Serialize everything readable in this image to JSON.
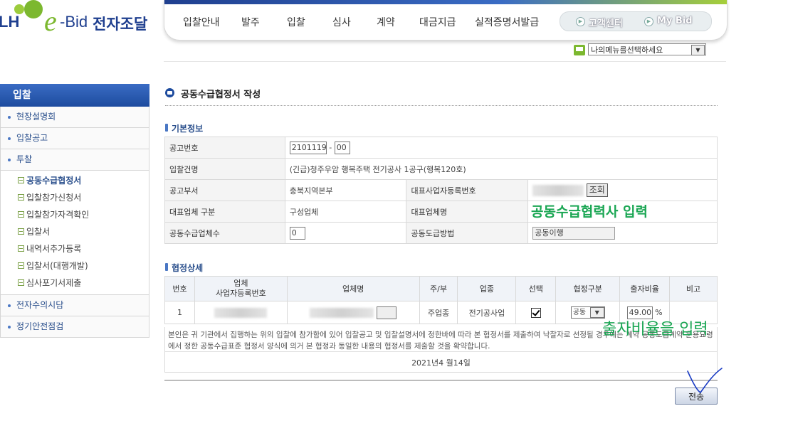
{
  "header": {
    "logo": {
      "lh": "LH",
      "e": "e",
      "bid": "-Bid",
      "korean": "전자조달"
    },
    "menus": [
      "입찰안내",
      "발주",
      "입찰",
      "심사",
      "계약",
      "대금지급",
      "실적증명서발급"
    ],
    "quick_links": [
      "고객센터",
      "My Bid"
    ],
    "my_menu_select": "나의메뉴를선택하세요"
  },
  "sidebar": {
    "title": "입찰",
    "items_top": [
      "현장설명회",
      "입찰공고",
      "투찰"
    ],
    "sub_items": [
      "공동수급협정서",
      "입찰참가신청서",
      "입찰참가자격확인",
      "입찰서",
      "내역서추가등록",
      "입찰서(대행개발)",
      "심사포기서제출"
    ],
    "items_bottom": [
      "전자수의시담",
      "정기안전점검"
    ]
  },
  "page": {
    "title": "공동수급협정서 작성",
    "basic_section": "기본정보",
    "detail_section": "협정상세"
  },
  "basic": {
    "labels": {
      "notice_no": "공고번호",
      "bid_name": "입찰건명",
      "dept": "공고부서",
      "rep_bizno": "대표사업자등록번호",
      "rep_type": "대표업체 구분",
      "rep_name": "대표업체명",
      "joint_count": "공동수급업체수",
      "joint_method": "공동도급방법"
    },
    "notice_no": "2101119",
    "notice_seq": "00",
    "bid_name": "(긴급)청주우암 행복주택 전기공사 1공구(행복120호)",
    "dept": "충북지역본부",
    "lookup_button": "조회",
    "rep_type": "구성업체",
    "joint_count": "0",
    "joint_method": "공동이행"
  },
  "detail": {
    "headers": [
      "번호",
      "업체\n사업자등록번호",
      "업체명",
      "주/부",
      "업종",
      "선택",
      "협정구분",
      "출자비율",
      "비고"
    ],
    "rows": [
      {
        "no": "1",
        "role": "주업종",
        "industry": "전기공사업",
        "agree_type": "공동",
        "ratio": "49.00",
        "unit": "%"
      }
    ]
  },
  "agreement": {
    "text": "본인은 귀 기관에서 집행하는 위의 입찰에 참가함에 있어 입찰공고 및 입찰설명서에 정한바에 따라 본 협정서를 제출하여 낙찰자로 선정될 경우에는 계약 공동도급계약 운용요령에서 정한 공동수급표준 협정서 양식에 의거 본 협정과 동일한 내용의 협정서를 제출할 것을 확약합니다.",
    "date": "2021년4 월14일"
  },
  "actions": {
    "send": "전송"
  },
  "annotations": {
    "first": "공동수급협력사 입력",
    "second": "출자비율을 입력"
  }
}
